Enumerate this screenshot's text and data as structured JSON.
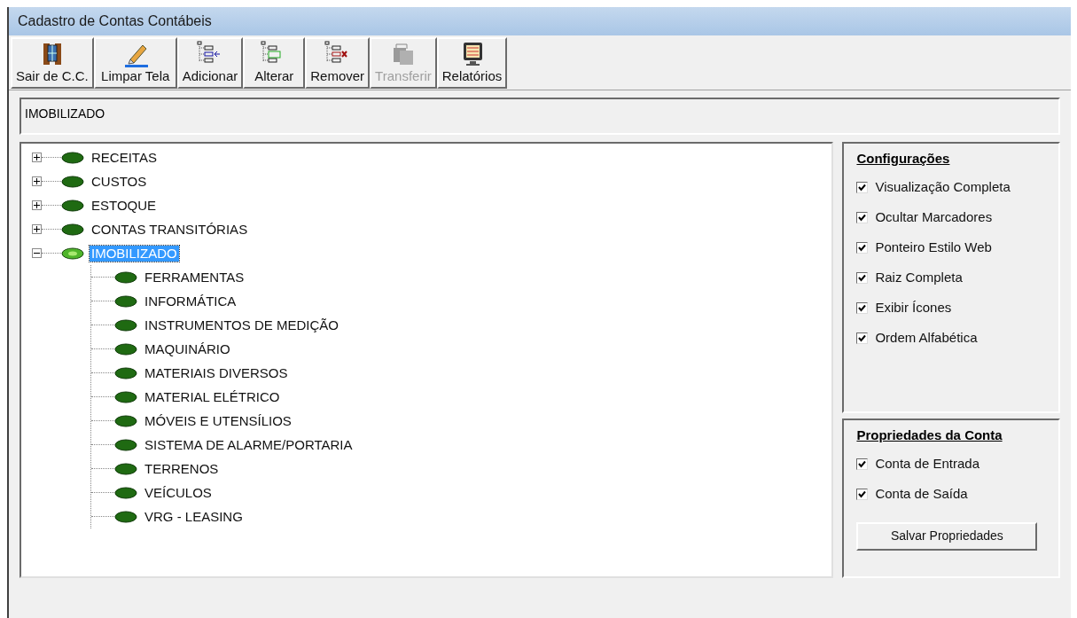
{
  "window": {
    "title": "Cadastro de Contas Contábeis"
  },
  "toolbar": [
    {
      "label": "Sair de C.C.",
      "kind": "exit",
      "disabled": false
    },
    {
      "label": "Limpar Tela",
      "kind": "eraser",
      "disabled": false
    },
    {
      "label": "Adicionar",
      "kind": "add",
      "disabled": false
    },
    {
      "label": "Alterar",
      "kind": "edit",
      "disabled": false
    },
    {
      "label": "Remover",
      "kind": "remove",
      "disabled": false
    },
    {
      "label": "Transferir",
      "kind": "transfer",
      "disabled": true
    },
    {
      "label": "Relatórios",
      "kind": "report",
      "disabled": false
    }
  ],
  "path_field": {
    "value": "IMOBILIZADO"
  },
  "tree": [
    {
      "label": "RECEITAS",
      "expanded": false,
      "selected": false
    },
    {
      "label": "CUSTOS",
      "expanded": false,
      "selected": false
    },
    {
      "label": "ESTOQUE",
      "expanded": false,
      "selected": false
    },
    {
      "label": "CONTAS TRANSITÓRIAS",
      "expanded": false,
      "selected": false
    },
    {
      "label": "IMOBILIZADO",
      "expanded": true,
      "selected": true,
      "children": [
        {
          "label": "FERRAMENTAS",
          "selected": false
        },
        {
          "label": "INFORMÁTICA",
          "selected": false
        },
        {
          "label": "INSTRUMENTOS DE MEDIÇÃO",
          "selected": false
        },
        {
          "label": "MAQUINÁRIO",
          "selected": false
        },
        {
          "label": "MATERIAIS DIVERSOS",
          "selected": false
        },
        {
          "label": "MATERIAL ELÉTRICO",
          "selected": false
        },
        {
          "label": "MÓVEIS E UTENSÍLIOS",
          "selected": false
        },
        {
          "label": "SISTEMA DE ALARME/PORTARIA",
          "selected": false
        },
        {
          "label": "TERRENOS",
          "selected": false
        },
        {
          "label": "VEÍCULOS",
          "selected": false
        },
        {
          "label": "VRG - LEASING",
          "selected": false
        }
      ]
    }
  ],
  "settings": {
    "title": "Configurações",
    "options": [
      {
        "label": "Visualização Completa",
        "checked": true
      },
      {
        "label": "Ocultar Marcadores",
        "checked": true
      },
      {
        "label": "Ponteiro Estilo Web",
        "checked": true
      },
      {
        "label": "Raiz Completa",
        "checked": true
      },
      {
        "label": "Exibir Ícones",
        "checked": true
      },
      {
        "label": "Ordem Alfabética",
        "checked": true
      }
    ]
  },
  "account_properties": {
    "title": "Propriedades da Conta",
    "options": [
      {
        "label": "Conta de Entrada",
        "checked": true
      },
      {
        "label": "Conta de Saída",
        "checked": true
      }
    ],
    "save_button": "Salvar Propriedades"
  }
}
